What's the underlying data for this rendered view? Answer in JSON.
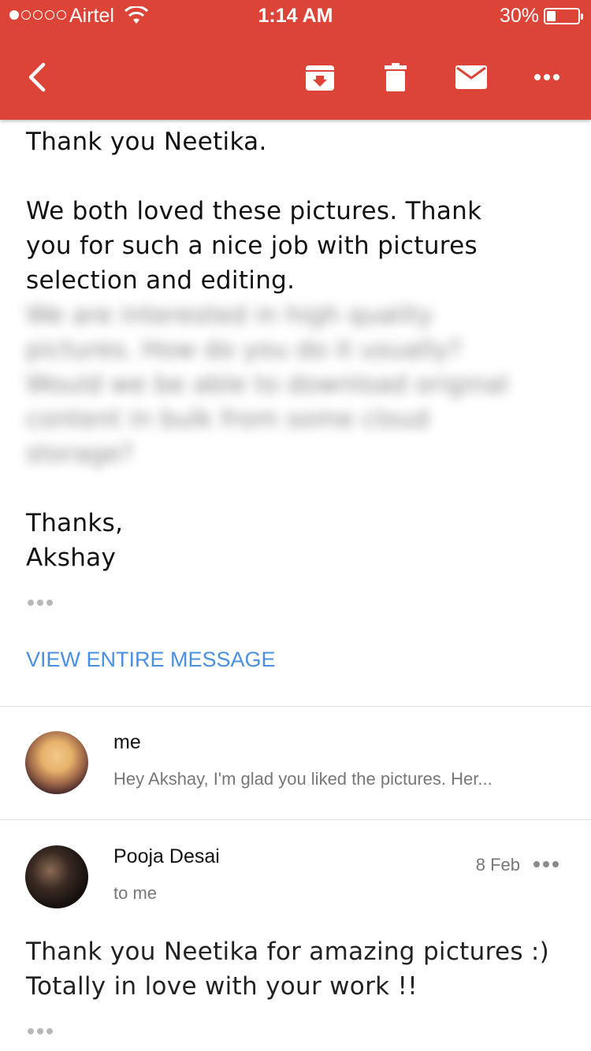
{
  "status_bar": {
    "carrier": "Airtel",
    "time": "1:14 AM",
    "battery_percent": "30%",
    "battery_level": 0.3,
    "signal_bars_on": 1,
    "signal_bars_total": 5
  },
  "app_bar": {
    "color": "#db4437",
    "icons": [
      "back-icon",
      "archive-icon",
      "delete-icon",
      "mail-icon",
      "more-icon"
    ]
  },
  "message1": {
    "lines": [
      "Thank you Neetika.",
      "We both loved these pictures. Thank",
      "you for such a nice job with pictures",
      "selection and editing.",
      "Thanks,",
      "Akshay"
    ],
    "blurred_lines": [
      "We are interested in high quality",
      "pictures. How do you do it usually?",
      "Would we be able to download original",
      "content in bulk from some cloud",
      "storage?"
    ],
    "view_entire_label": "VIEW ENTIRE MESSAGE"
  },
  "collapsed_message": {
    "sender": "me",
    "snippet": "Hey Akshay, I'm glad you liked the pictures. Her..."
  },
  "message2": {
    "sender": "Pooja Desai",
    "recipient": "to me",
    "date": "8 Feb",
    "lines": [
      "Thank you Neetika for amazing pictures :)",
      "Totally in love with your work !!"
    ]
  }
}
